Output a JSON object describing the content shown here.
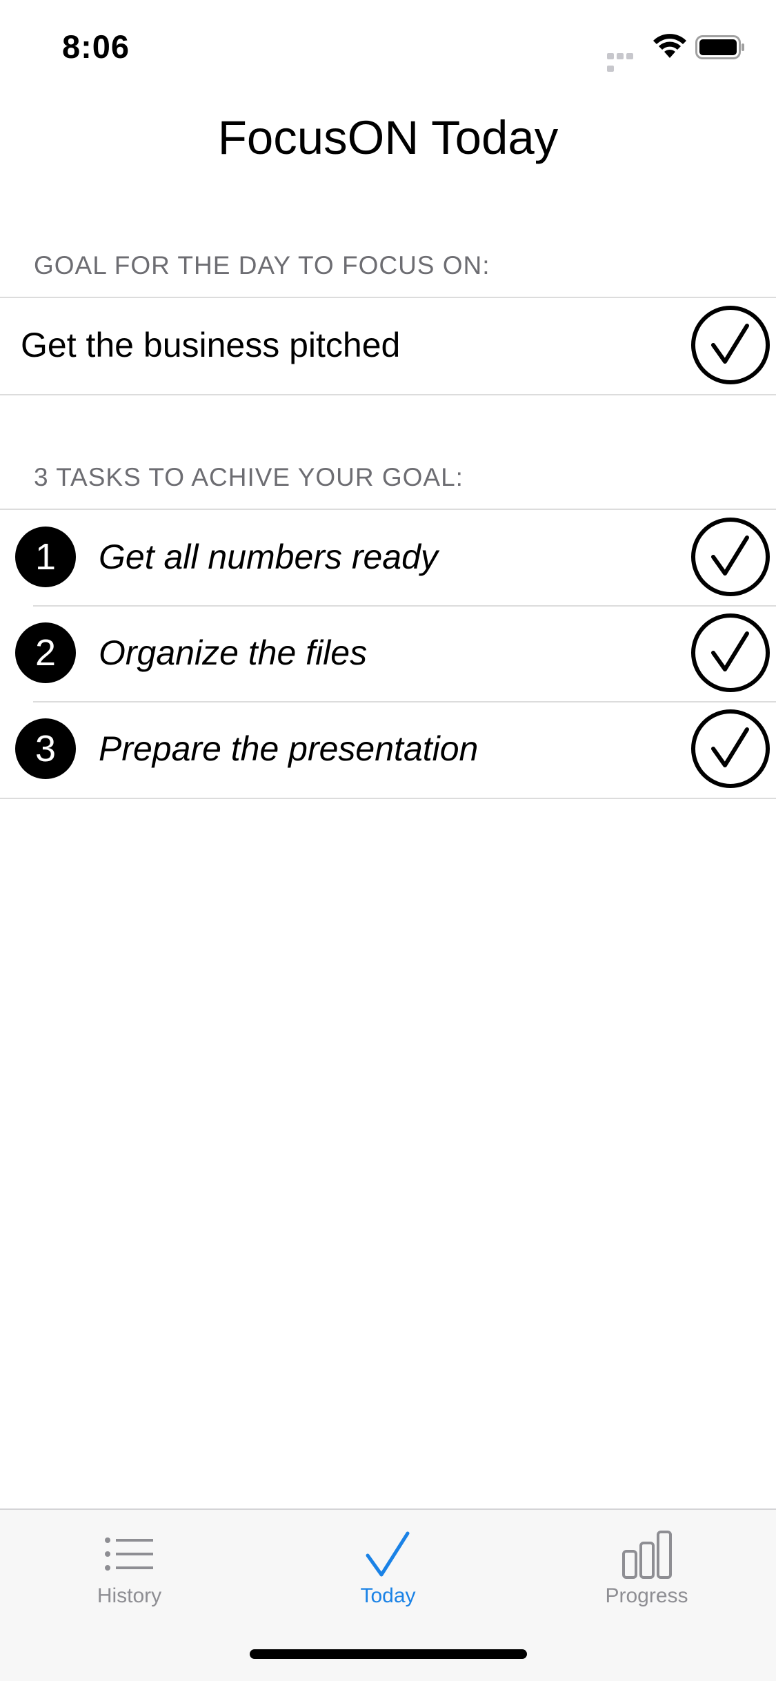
{
  "status_bar": {
    "time": "8:06"
  },
  "header": {
    "title": "FocusON Today"
  },
  "goal_section": {
    "header": "GOAL FOR THE DAY TO FOCUS ON:",
    "goal": "Get the business pitched"
  },
  "tasks_section": {
    "header": "3 TASKS TO ACHIVE YOUR GOAL:",
    "tasks": [
      {
        "number": "1",
        "label": "Get all numbers ready"
      },
      {
        "number": "2",
        "label": "Organize the files"
      },
      {
        "number": "3",
        "label": "Prepare the presentation"
      }
    ]
  },
  "tab_bar": {
    "tabs": [
      {
        "label": "History",
        "icon": "list-icon",
        "active": false
      },
      {
        "label": "Today",
        "icon": "checkmark-icon",
        "active": true
      },
      {
        "label": "Progress",
        "icon": "bar-chart-icon",
        "active": false
      }
    ]
  },
  "colors": {
    "accent": "#1a82e6",
    "inactive": "#8e8e93",
    "section_header": "#6d6d72"
  }
}
